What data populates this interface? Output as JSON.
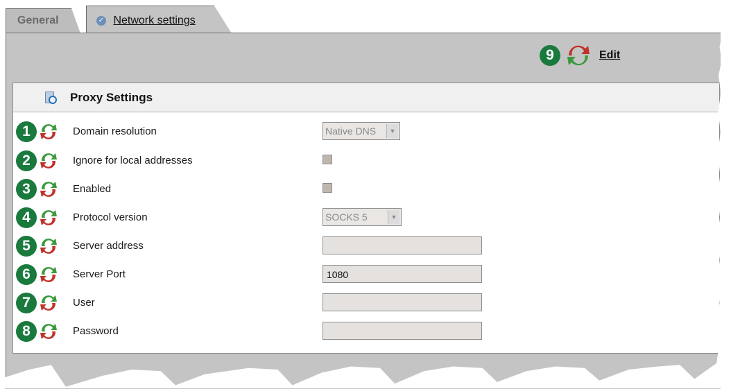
{
  "tabs": [
    {
      "label": "General"
    },
    {
      "label": "Network settings"
    }
  ],
  "edit": {
    "badge": "9",
    "label": "Edit"
  },
  "section": {
    "title": "Proxy Settings"
  },
  "rows": [
    {
      "badge": "1",
      "label": "Domain resolution",
      "control": "select",
      "value": "Native DNS"
    },
    {
      "badge": "2",
      "label": "Ignore for local addresses",
      "control": "checkbox"
    },
    {
      "badge": "3",
      "label": "Enabled",
      "control": "checkbox"
    },
    {
      "badge": "4",
      "label": "Protocol version",
      "control": "select",
      "value": "SOCKS 5"
    },
    {
      "badge": "5",
      "label": "Server address",
      "control": "text",
      "value": ""
    },
    {
      "badge": "6",
      "label": "Server Port",
      "control": "text",
      "value": "1080"
    },
    {
      "badge": "7",
      "label": "User",
      "control": "text",
      "value": ""
    },
    {
      "badge": "8",
      "label": "Password",
      "control": "text",
      "value": ""
    }
  ],
  "colors": {
    "badge": "#1a7a3e",
    "refresh_green": "#3c9a3c",
    "refresh_red": "#c0322a",
    "panel": "#c4c4c4"
  },
  "icons": {
    "tab_check": "check-circle-icon",
    "header": "document-magnifier-icon",
    "row": "refresh-icon"
  }
}
